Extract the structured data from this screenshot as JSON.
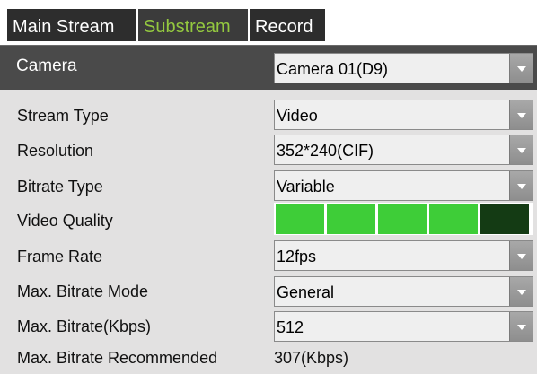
{
  "tabs": {
    "main_stream": "Main Stream",
    "substream": "Substream",
    "record": "Record"
  },
  "camera": {
    "label": "Camera",
    "value": "Camera 01(D9)"
  },
  "fields": {
    "stream_type": {
      "label": "Stream Type",
      "value": "Video"
    },
    "resolution": {
      "label": "Resolution",
      "value": "352*240(CIF)"
    },
    "bitrate_type": {
      "label": "Bitrate Type",
      "value": "Variable"
    },
    "video_quality": {
      "label": "Video Quality",
      "level": 4,
      "max": 5
    },
    "frame_rate": {
      "label": "Frame Rate",
      "value": "12fps"
    },
    "max_bitrate_mode": {
      "label": "Max. Bitrate Mode",
      "value": "General"
    },
    "max_bitrate": {
      "label": "Max. Bitrate(Kbps)",
      "value": "512"
    },
    "recommended": {
      "label": "Max. Bitrate Recommended",
      "value": "307(Kbps)"
    }
  },
  "colors": {
    "active_tab_text": "#94c93f",
    "quality_on": "#3ecd38",
    "quality_off": "#143b14"
  }
}
